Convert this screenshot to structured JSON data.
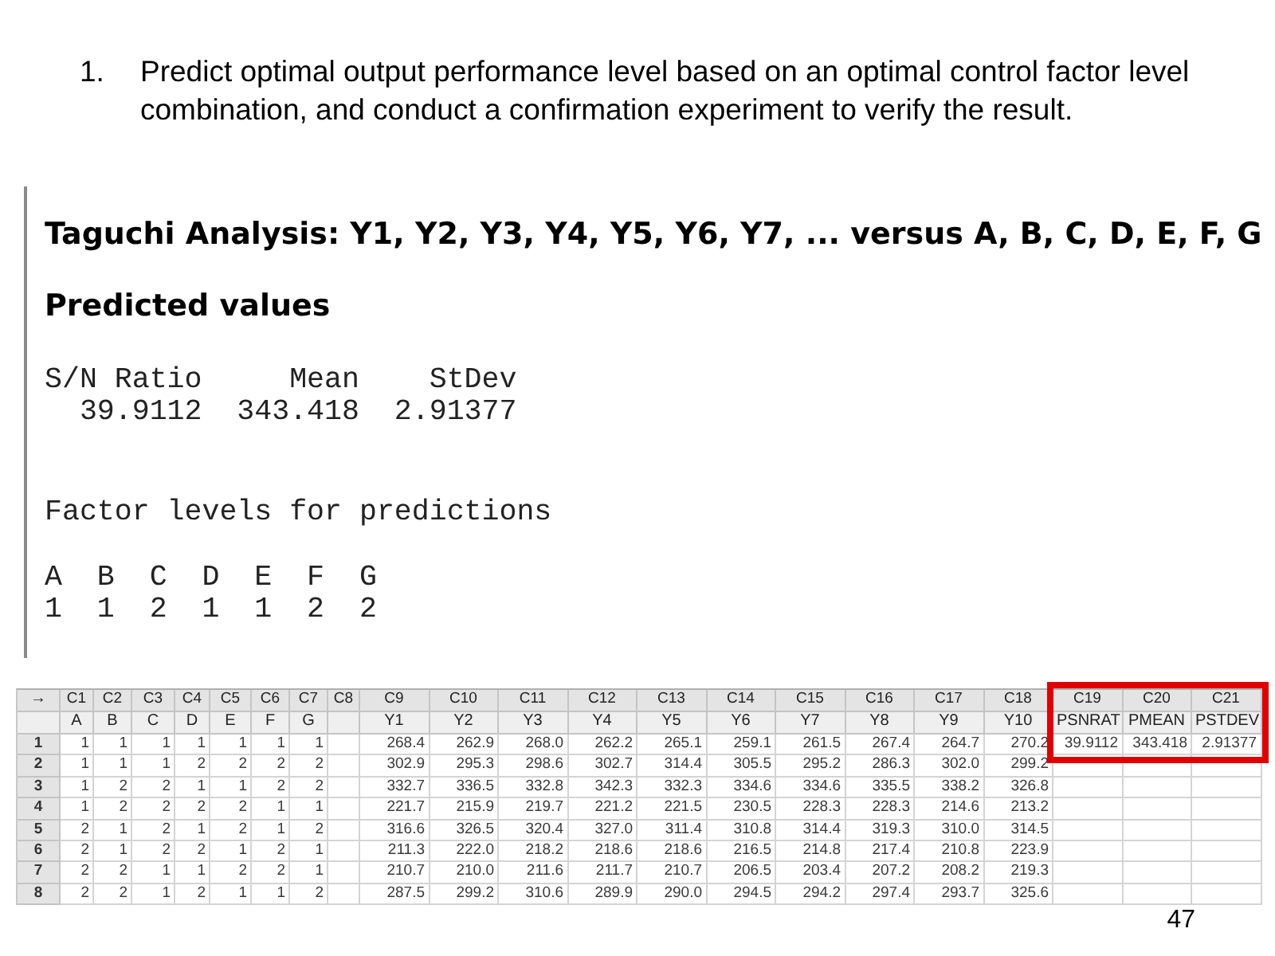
{
  "slide": {
    "item": {
      "number": "1.",
      "text": "Predict optimal output performance level based on an optimal control factor level combination, and conduct a confirmation experiment to verify the result."
    }
  },
  "session": {
    "title": "Taguchi Analysis: Y1, Y2, Y3, Y4, Y5, Y6, Y7, ... versus A, B, C, D, E, F, G",
    "subtitle": "Predicted values",
    "predicted": {
      "headers": [
        "S/N Ratio",
        "Mean",
        "StDev"
      ],
      "values": [
        "39.9112",
        "343.418",
        "2.91377"
      ]
    },
    "factor_heading": "Factor levels for predictions",
    "factors": [
      {
        "name": "A",
        "level": "1"
      },
      {
        "name": "B",
        "level": "1"
      },
      {
        "name": "C",
        "level": "2"
      },
      {
        "name": "D",
        "level": "1"
      },
      {
        "name": "E",
        "level": "1"
      },
      {
        "name": "F",
        "level": "2"
      },
      {
        "name": "G",
        "level": "2"
      }
    ]
  },
  "worksheet": {
    "corner": "→",
    "columns": [
      {
        "id": "C1",
        "name": "A",
        "highlighted": false
      },
      {
        "id": "C2",
        "name": "B",
        "highlighted": false
      },
      {
        "id": "C3",
        "name": "C",
        "highlighted": false
      },
      {
        "id": "C4",
        "name": "D",
        "highlighted": false
      },
      {
        "id": "C5",
        "name": "E",
        "highlighted": false
      },
      {
        "id": "C6",
        "name": "F",
        "highlighted": false
      },
      {
        "id": "C7",
        "name": "G",
        "highlighted": false
      },
      {
        "id": "C8",
        "highlighted": false
      },
      {
        "id": "C9",
        "name": "Y1",
        "highlighted": false
      },
      {
        "id": "C10",
        "name": "Y2",
        "highlighted": false
      },
      {
        "id": "C11",
        "name": "Y3",
        "highlighted": false
      },
      {
        "id": "C12",
        "name": "Y4",
        "highlighted": false
      },
      {
        "id": "C13",
        "name": "Y5",
        "highlighted": false
      },
      {
        "id": "C14",
        "name": "Y6",
        "highlighted": false
      },
      {
        "id": "C15",
        "name": "Y7",
        "highlighted": false
      },
      {
        "id": "C16",
        "name": "Y8",
        "highlighted": false
      },
      {
        "id": "C17",
        "name": "Y9",
        "highlighted": false
      },
      {
        "id": "C18",
        "name": "Y10",
        "highlighted": false
      },
      {
        "id": "C19",
        "name": "PSNRAT",
        "highlighted": true
      },
      {
        "id": "C20",
        "name": "PMEAN",
        "highlighted": true
      },
      {
        "id": "C21",
        "name": "PSTDEV",
        "highlighted": true
      }
    ],
    "rows": [
      {
        "number": "1",
        "highlighted": true,
        "cells": [
          "1",
          "1",
          "1",
          "1",
          "1",
          "1",
          "1",
          null,
          "268.4",
          "262.9",
          "268.0",
          "262.2",
          "265.1",
          "259.1",
          "261.5",
          "267.4",
          "264.7",
          "270.2",
          "39.9112",
          "343.418",
          "2.91377"
        ]
      },
      {
        "number": "2",
        "highlighted": false,
        "cells": [
          "1",
          "1",
          "1",
          "2",
          "2",
          "2",
          "2",
          null,
          "302.9",
          "295.3",
          "298.6",
          "302.7",
          "314.4",
          "305.5",
          "295.2",
          "286.3",
          "302.0",
          "299.2",
          null,
          null,
          null
        ]
      },
      {
        "number": "3",
        "highlighted": false,
        "cells": [
          "1",
          "2",
          "2",
          "1",
          "1",
          "2",
          "2",
          null,
          "332.7",
          "336.5",
          "332.8",
          "342.3",
          "332.3",
          "334.6",
          "334.6",
          "335.5",
          "338.2",
          "326.8",
          null,
          null,
          null
        ]
      },
      {
        "number": "4",
        "highlighted": false,
        "cells": [
          "1",
          "2",
          "2",
          "2",
          "2",
          "1",
          "1",
          null,
          "221.7",
          "215.9",
          "219.7",
          "221.2",
          "221.5",
          "230.5",
          "228.3",
          "228.3",
          "214.6",
          "213.2",
          null,
          null,
          null
        ]
      },
      {
        "number": "5",
        "highlighted": false,
        "cells": [
          "2",
          "1",
          "2",
          "1",
          "2",
          "1",
          "2",
          null,
          "316.6",
          "326.5",
          "320.4",
          "327.0",
          "311.4",
          "310.8",
          "314.4",
          "319.3",
          "310.0",
          "314.5",
          null,
          null,
          null
        ]
      },
      {
        "number": "6",
        "highlighted": false,
        "cells": [
          "2",
          "1",
          "2",
          "2",
          "1",
          "2",
          "1",
          null,
          "211.3",
          "222.0",
          "218.2",
          "218.6",
          "218.6",
          "216.5",
          "214.8",
          "217.4",
          "210.8",
          "223.9",
          null,
          null,
          null
        ]
      },
      {
        "number": "7",
        "highlighted": false,
        "cells": [
          "2",
          "2",
          "1",
          "1",
          "2",
          "2",
          "1",
          null,
          "210.7",
          "210.0",
          "211.6",
          "211.7",
          "210.7",
          "206.5",
          "203.4",
          "207.2",
          "208.2",
          "219.3",
          null,
          null,
          null
        ]
      },
      {
        "number": "8",
        "highlighted": false,
        "cells": [
          "2",
          "2",
          "1",
          "2",
          "1",
          "1",
          "2",
          null,
          "287.5",
          "299.2",
          "310.6",
          "289.9",
          "290.0",
          "294.5",
          "294.2",
          "297.4",
          "293.7",
          "325.6",
          null,
          null,
          null
        ]
      }
    ]
  },
  "page_number": "47"
}
